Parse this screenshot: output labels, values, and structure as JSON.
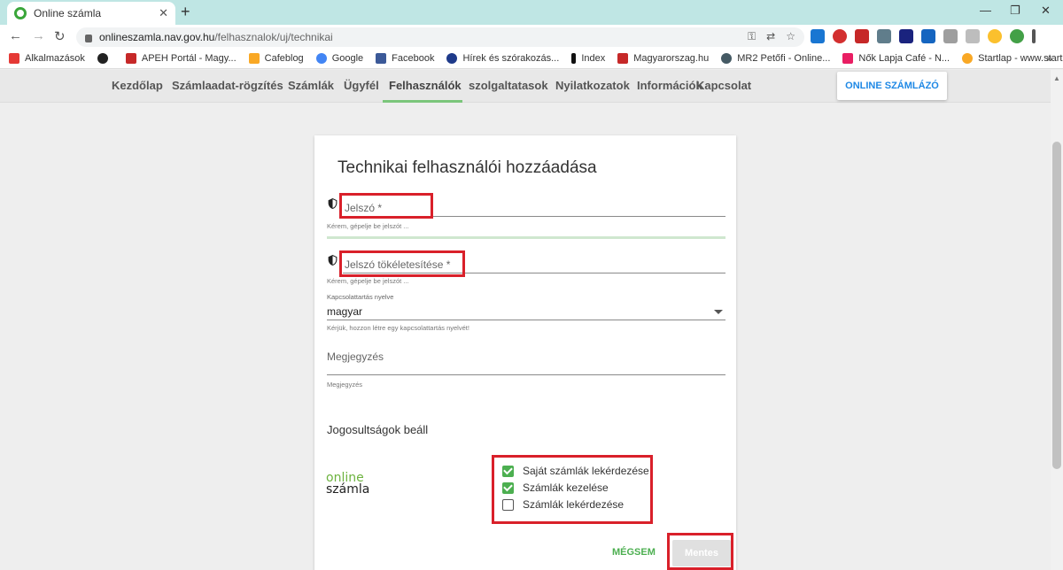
{
  "browser": {
    "tab_title": "Online számla",
    "url_host": "onlineszamla.nav.gov.hu",
    "url_path": "/felhasznalok/uj/technikai",
    "bookmarks": [
      {
        "label": "Alkalmazások",
        "color": "#e53935"
      },
      {
        "label": "",
        "color": "#222222"
      },
      {
        "label": "APEH Portál - Magy...",
        "color": "#c62828"
      },
      {
        "label": "Cafeblog",
        "color": "#f9a825"
      },
      {
        "label": "Google",
        "color": "#4285f4"
      },
      {
        "label": "Facebook",
        "color": "#3b5998"
      },
      {
        "label": "Hírek és szórakozás...",
        "color": "#1e3a8a"
      },
      {
        "label": "Index",
        "color": "#111111"
      },
      {
        "label": "Magyarorszag.hu",
        "color": "#c62828"
      },
      {
        "label": "MR2 Petőfi - Online...",
        "color": "#455a64"
      },
      {
        "label": "Nők Lapja Café - N...",
        "color": "#e91e63"
      },
      {
        "label": "Startlap - www.start...",
        "color": "#f9a825"
      }
    ]
  },
  "nav": {
    "items": [
      {
        "label": "Kezdőlap",
        "active": false
      },
      {
        "label": "Számlaadat-rögzítés",
        "active": false
      },
      {
        "label": "Számlák",
        "active": false
      },
      {
        "label": "Ügyfél",
        "active": false
      },
      {
        "label": "Felhasználók",
        "active": true
      },
      {
        "label": "szolgaltatasok",
        "active": false
      },
      {
        "label": "Nyilatkozatok",
        "active": false
      },
      {
        "label": "Információk",
        "active": false
      },
      {
        "label": "Kapcsolat",
        "active": false
      }
    ],
    "online_button": "ONLINE SZÁMLÁZÓ"
  },
  "form": {
    "title": "Technikai felhasználói hozzáadása",
    "password_label": "Jelszó *",
    "password_hint": "Kérem, gépelje be jelszót ...",
    "password_confirm_label": "Jelszó tökéletesítése *",
    "password_confirm_hint": "Kérem, gépelje be jelszót ...",
    "language_label": "Kapcsolattartás nyelve",
    "language_value": "magyar",
    "language_hint": "Kérjük, hozzon létre egy kapcsolattartás nyelvét!",
    "note_label": "Megjegyzés",
    "note_hint": "Megjegyzés",
    "permissions_title": "Jogosultságok beáll",
    "logo_line1": "online",
    "logo_line2": "számla",
    "permissions": [
      {
        "label": "Saját számlák lekérdezése",
        "checked": true
      },
      {
        "label": "Számlák kezelése",
        "checked": true
      },
      {
        "label": "Számlák lekérdezése",
        "checked": false
      }
    ],
    "cancel_label": "MÉGSEM",
    "save_label": "Mentes"
  },
  "colors": {
    "accent_green": "#4caf50",
    "highlight_red": "#d9202a",
    "link_blue": "#1e88e5"
  }
}
